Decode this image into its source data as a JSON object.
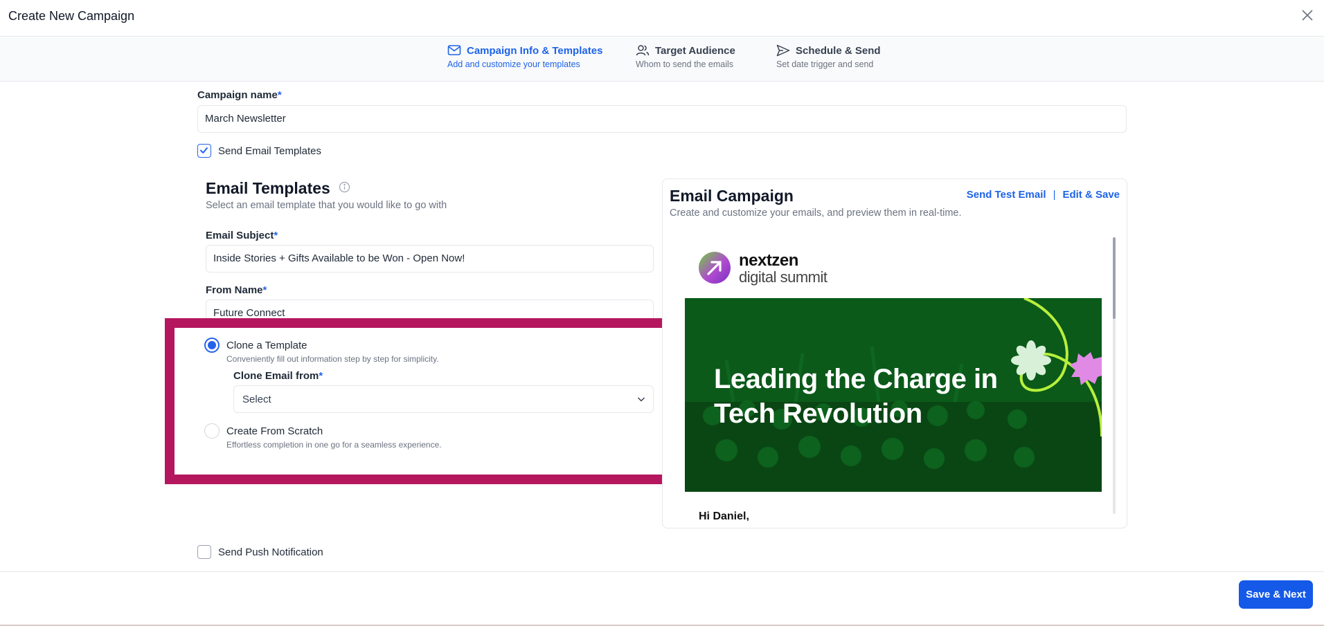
{
  "header": {
    "title": "Create New Campaign",
    "close_icon": "close-icon"
  },
  "stepper": [
    {
      "label": "Campaign Info & Templates",
      "sub": "Add and customize your templates",
      "icon": "mail-icon",
      "active": true
    },
    {
      "label": "Target Audience",
      "sub": "Whom to send the emails",
      "icon": "users-icon",
      "active": false
    },
    {
      "label": "Schedule & Send",
      "sub": "Set date trigger and send",
      "icon": "send-icon",
      "active": false
    }
  ],
  "form": {
    "campaign_name_label": "Campaign name",
    "required_mark": "*",
    "campaign_name_value": "March Newsletter",
    "send_email_templates_label": "Send Email Templates",
    "send_email_templates_checked": true,
    "email_templates_title": "Email Templates",
    "email_templates_sub": "Select an email template that you would like to go with",
    "email_subject_label": "Email Subject",
    "email_subject_value": "Inside Stories + Gifts Available to be Won - Open Now!",
    "from_name_label": "From Name",
    "from_name_value": "Future Connect",
    "clone_title": "Clone a Template",
    "clone_sub": "Conveniently fill out information step by step for simplicity.",
    "clone_from_label": "Clone Email from",
    "clone_select_value": "Select",
    "scratch_title": "Create From Scratch",
    "scratch_sub": "Effortless completion in one go for a seamless experience.",
    "send_push_label": "Send Push Notification",
    "send_push_checked": false
  },
  "preview": {
    "title": "Email Campaign",
    "sub": "Create and customize your emails, and preview them in real-time.",
    "send_test": "Send Test Email",
    "separator": "|",
    "edit_save": "Edit & Save",
    "logo_line1": "nextzen",
    "logo_line2": "digital summit",
    "banner_text": "Leading the Charge in Tech Revolution",
    "greeting": "Hi Daniel,"
  },
  "footer": {
    "save_next": "Save & Next"
  },
  "colors": {
    "accent": "#1d63e8",
    "highlight": "#b5175f",
    "banner": "#0c4f18",
    "lime": "#b7f03c"
  }
}
